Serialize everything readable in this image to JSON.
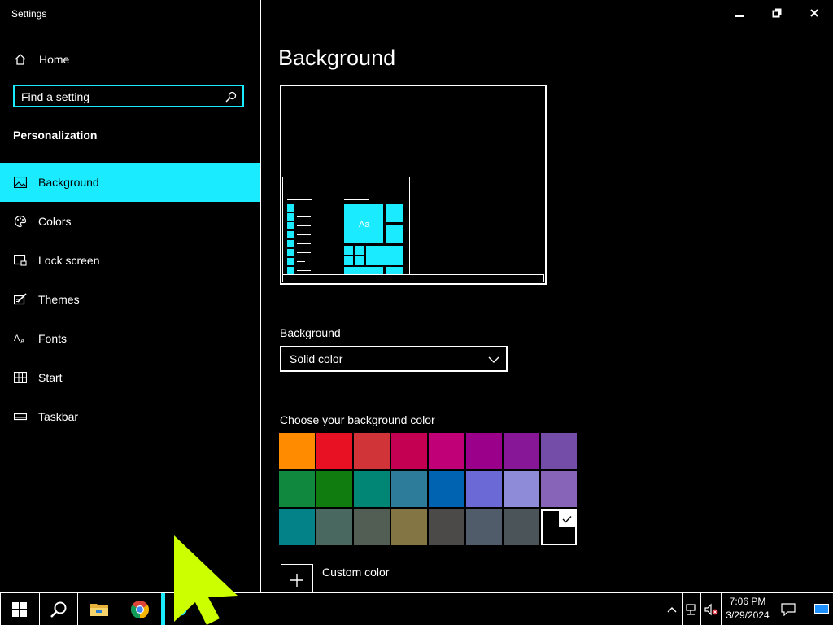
{
  "window": {
    "title": "Settings"
  },
  "sidebar": {
    "home_label": "Home",
    "search": {
      "placeholder": "Find a setting",
      "value": ""
    },
    "section_title": "Personalization",
    "items": [
      {
        "label": "Background",
        "icon": "picture-icon",
        "active": true
      },
      {
        "label": "Colors",
        "icon": "palette-icon",
        "active": false
      },
      {
        "label": "Lock screen",
        "icon": "lock-screen-icon",
        "active": false
      },
      {
        "label": "Themes",
        "icon": "themes-icon",
        "active": false
      },
      {
        "label": "Fonts",
        "icon": "fonts-icon",
        "active": false
      },
      {
        "label": "Start",
        "icon": "start-icon",
        "active": false
      },
      {
        "label": "Taskbar",
        "icon": "taskbar-icon",
        "active": false
      }
    ]
  },
  "main": {
    "title": "Background",
    "preview": {
      "tile_text": "Aa"
    },
    "background_label": "Background",
    "background_select": "Solid color",
    "colors_label": "Choose your background color",
    "swatches": [
      "#ff8c00",
      "#e81123",
      "#d13438",
      "#c30052",
      "#bf0077",
      "#9a0089",
      "#881798",
      "#744da9",
      "#10893e",
      "#107c10",
      "#018574",
      "#2d7d9a",
      "#0063b1",
      "#6b69d6",
      "#8e8cd8",
      "#8764b8",
      "#038387",
      "#486860",
      "#525e54",
      "#847545",
      "#4c4a48",
      "#515c6b",
      "#4a5459",
      "#000000"
    ],
    "selected_swatch": 23,
    "custom_color_label": "Custom color"
  },
  "taskbar": {
    "time": "7:06 PM",
    "date": "3/29/2024",
    "accent": "#1aebff"
  },
  "colors": {
    "accent": "#1aebff",
    "background": "#000000",
    "cursor": "#ccff00"
  }
}
